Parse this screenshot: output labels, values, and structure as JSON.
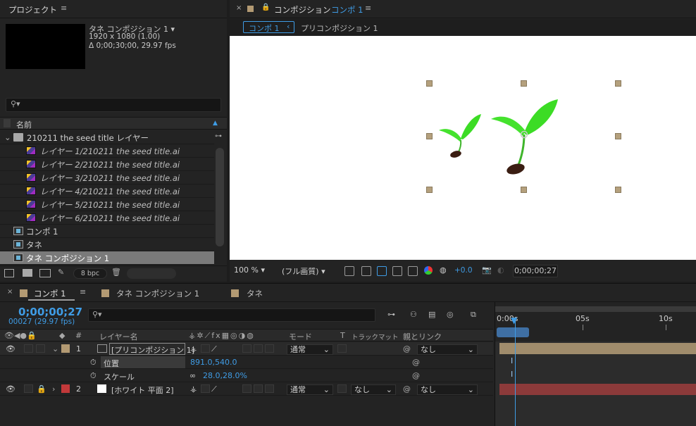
{
  "project": {
    "title": "プロジェクト",
    "menu_icon": "hamburger-icon",
    "selected_name": "タネ コンポジション 1 ▾",
    "resolution": "1920 x 1080 (1.00)",
    "duration": "Δ 0;00;30;00, 29.97 fps",
    "column_name": "名前",
    "folder": "210211 the seed title レイヤー",
    "items": [
      {
        "name": "レイヤー 1/210211 the seed title.ai",
        "type": "ai"
      },
      {
        "name": "レイヤー 2/210211 the seed title.ai",
        "type": "ai"
      },
      {
        "name": "レイヤー 3/210211 the seed title.ai",
        "type": "ai"
      },
      {
        "name": "レイヤー 4/210211 the seed title.ai",
        "type": "ai"
      },
      {
        "name": "レイヤー 5/210211 the seed title.ai",
        "type": "ai"
      },
      {
        "name": "レイヤー 6/210211 the seed title.ai",
        "type": "ai"
      },
      {
        "name": "コンポ 1",
        "type": "comp"
      },
      {
        "name": "タネ",
        "type": "folder-comp"
      },
      {
        "name": "タネ コンポジション 1",
        "type": "comp",
        "selected": true
      }
    ],
    "bpc": "8 bpc"
  },
  "viewer": {
    "title": "コンポジション",
    "comp_name": "コンポ 1",
    "flow": [
      "コンポ 1",
      "プリコンポジション 1"
    ],
    "zoom": "100 %",
    "quality": "(フル画質)",
    "exposure": "+0.0",
    "timecode": "0;00;00;27"
  },
  "timeline": {
    "tabs": [
      "コンポ 1",
      "タネ コンポジション 1",
      "タネ"
    ],
    "time": "0;00;00;27",
    "frames": "00027 (29.97 fps)",
    "col_num": "#",
    "col_layer": "レイヤー名",
    "col_mode": "モード",
    "col_t": "T",
    "col_trackmatte": "トラックマット",
    "col_parent": "親とリンク",
    "ruler": [
      "0:00s",
      "05s",
      "10s"
    ],
    "layers": [
      {
        "num": "1",
        "name": "[プリコンポジション 1]",
        "mode": "通常",
        "parent": "なし",
        "color": "#b39a73"
      },
      {
        "num": "2",
        "name": "[ホワイト 平面 2]",
        "mode": "通常",
        "matte": "なし",
        "parent": "なし",
        "color": "#c2393a"
      }
    ],
    "props": [
      {
        "label": "位置",
        "value": "891.0,540.0"
      },
      {
        "label": "スケール",
        "value": "28.0,28.0%"
      }
    ]
  },
  "colors": {
    "accent": "#3f9ce5",
    "layer1": "#b39a73",
    "layer2": "#c2393a",
    "sprout": "#3ee62a"
  }
}
